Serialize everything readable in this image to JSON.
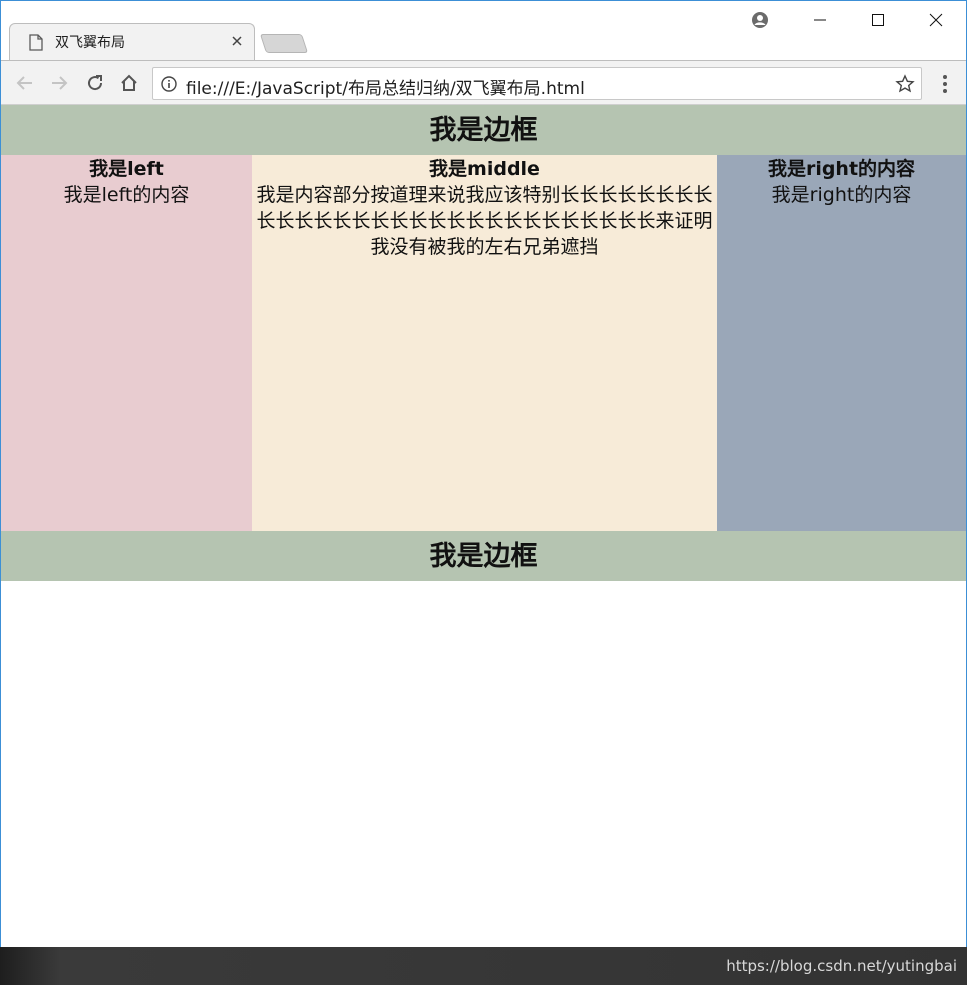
{
  "browser": {
    "tab_title": "双飞翼布局",
    "url": "file:///E:/JavaScript/布局总结归纳/双飞翼布局.html"
  },
  "page": {
    "header_text": "我是边框",
    "footer_text": "我是边框",
    "left": {
      "heading": "我是left",
      "text": "我是left的内容"
    },
    "middle": {
      "heading": "我是middle",
      "text": "我是内容部分按道理来说我应该特别长长长长长长长长长长长长长长长长长长长长长长长长长长长长长来证明我没有被我的左右兄弟遮挡"
    },
    "right": {
      "heading": "我是right的内容",
      "text": "我是right的内容"
    }
  },
  "watermark": "https://blog.csdn.net/yutingbai",
  "colors": {
    "band": "#b5c4b1",
    "left": "#e8ccd0",
    "middle": "#f7ebd8",
    "right": "#9aa7b8"
  },
  "icons": {
    "tab": "document-icon",
    "close": "close-icon",
    "profile": "account-icon",
    "minimize": "minimize-icon",
    "maximize": "maximize-icon",
    "window_close": "window-close-icon",
    "back": "back-arrow-icon",
    "forward": "forward-arrow-icon",
    "reload": "reload-icon",
    "home": "home-icon",
    "info": "info-icon",
    "star": "star-icon",
    "menu": "kebab-menu-icon"
  }
}
